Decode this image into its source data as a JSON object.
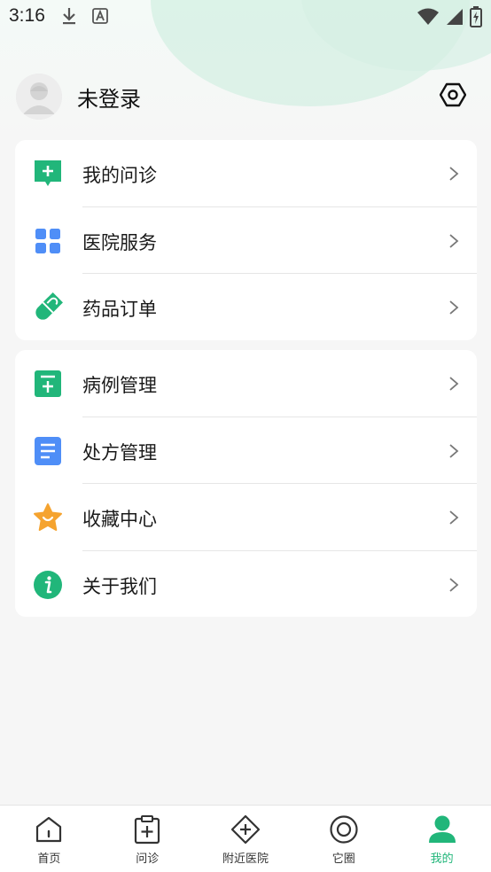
{
  "status_bar": {
    "time": "3:16",
    "icons": [
      "download-icon",
      "font-a-icon",
      "wifi-icon",
      "signal-icon",
      "battery-charging-icon"
    ]
  },
  "profile": {
    "name": "未登录",
    "avatar_icon": "default-avatar-icon",
    "settings_icon": "settings-hexagon-icon"
  },
  "menu_group_1": [
    {
      "label": "我的问诊",
      "icon": "consult-chat-plus-icon"
    },
    {
      "label": "医院服务",
      "icon": "grid-apps-icon"
    },
    {
      "label": "药品订单",
      "icon": "pill-capsule-icon"
    }
  ],
  "menu_group_2": [
    {
      "label": "病例管理",
      "icon": "medical-record-icon"
    },
    {
      "label": "处方管理",
      "icon": "prescription-list-icon"
    },
    {
      "label": "收藏中心",
      "icon": "star-favorite-icon"
    },
    {
      "label": "关于我们",
      "icon": "info-icon"
    }
  ],
  "bottom_nav": [
    {
      "label": "首页",
      "icon": "home-icon",
      "active": false
    },
    {
      "label": "问诊",
      "icon": "clipboard-plus-icon",
      "active": false
    },
    {
      "label": "附近医院",
      "icon": "hospital-diamond-icon",
      "active": false
    },
    {
      "label": "它圈",
      "icon": "circle-ring-icon",
      "active": false
    },
    {
      "label": "我的",
      "icon": "person-icon",
      "active": true
    }
  ],
  "colors": {
    "accent_green": "#21b67a",
    "blue": "#4f8ef7",
    "orange": "#f5a32f",
    "background": "#f6f6f6"
  }
}
